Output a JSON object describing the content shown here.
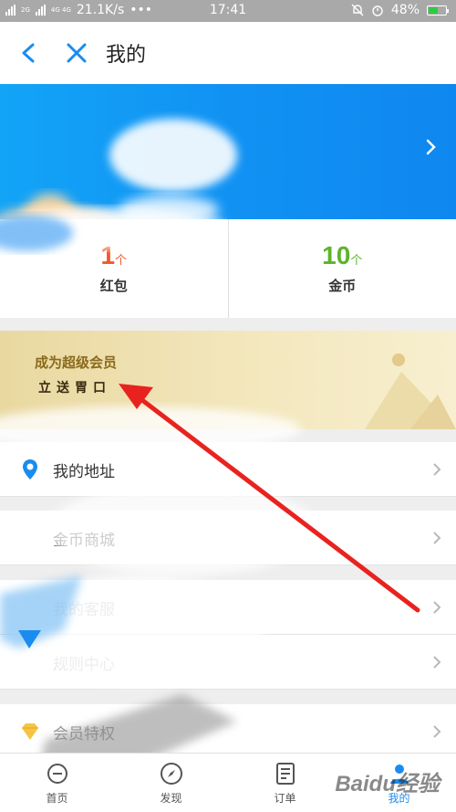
{
  "status_bar": {
    "carrier_left": "2G",
    "carrier_right": "4G 4G",
    "speed": "21.1K/s",
    "dots": "•••",
    "time": "17:41",
    "battery_percent": "48%",
    "battery_level": 0.48
  },
  "titlebar": {
    "title": "我的",
    "back_icon": "chevron-left-icon",
    "close_icon": "close-icon"
  },
  "stats": [
    {
      "value": "1",
      "unit": "个",
      "label": "红包",
      "color": "#f25a2b"
    },
    {
      "value": "10",
      "unit": "个",
      "label": "金币",
      "color": "#5ab52b"
    }
  ],
  "vip": {
    "title": "成为超级会员",
    "subtitle": "立送胃口"
  },
  "menu": [
    {
      "label": "我的地址",
      "icon": "location-pin-icon"
    },
    {
      "label": "金币商城",
      "icon": "coin-icon"
    },
    {
      "label": "我的客服",
      "icon": "customer-service-icon"
    },
    {
      "label": "规则中心",
      "icon": "rules-icon"
    },
    {
      "label": "会员特权",
      "icon": "diamond-icon"
    }
  ],
  "bottom_nav": [
    {
      "label": "首页",
      "icon": "home-icon"
    },
    {
      "label": "发现",
      "icon": "compass-icon"
    },
    {
      "label": "订单",
      "icon": "order-icon"
    },
    {
      "label": "我的",
      "icon": "profile-icon",
      "active": true
    }
  ],
  "colors": {
    "accent_blue": "#1a8cf0",
    "arrow_red": "#e8231f",
    "vip_gold": "#e9d8a0"
  },
  "watermark": "Baidu经验"
}
